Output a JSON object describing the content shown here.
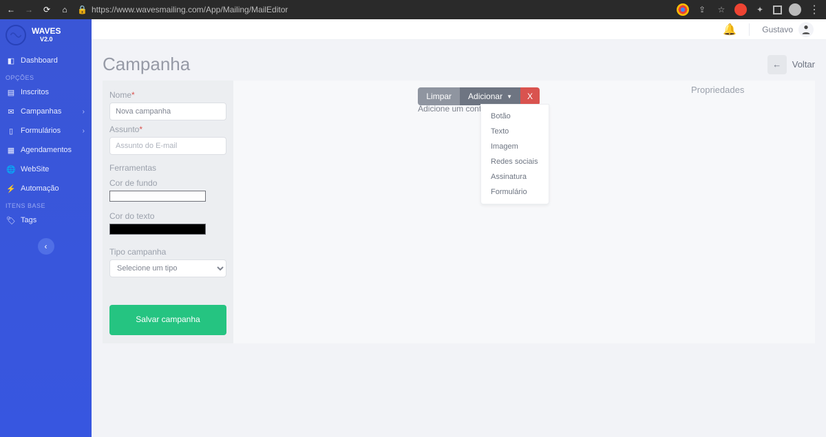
{
  "browser": {
    "url": "https://www.wavesmailing.com/App/Mailing/MailEditor"
  },
  "brand": {
    "name": "WAVES",
    "version": "V2.0"
  },
  "sidebar": {
    "items": [
      {
        "label": "Dashboard",
        "icon": "dashboard",
        "expandable": false
      },
      {
        "section": "OPÇÕES"
      },
      {
        "label": "Inscritos",
        "icon": "users",
        "expandable": false
      },
      {
        "label": "Campanhas",
        "icon": "envelope",
        "expandable": true
      },
      {
        "label": "Formulários",
        "icon": "file",
        "expandable": true
      },
      {
        "label": "Agendamentos",
        "icon": "calendar",
        "expandable": false
      },
      {
        "label": "WebSite",
        "icon": "globe",
        "expandable": false
      },
      {
        "label": "Automação",
        "icon": "bolt",
        "expandable": false
      },
      {
        "section": "ITENS BASE"
      },
      {
        "label": "Tags",
        "icon": "tag",
        "expandable": false
      }
    ]
  },
  "topbar": {
    "username": "Gustavo"
  },
  "page": {
    "title": "Campanha",
    "back_label": "Voltar"
  },
  "form": {
    "name_label": "Nome",
    "name_value": "Nova campanha",
    "subject_label": "Assunto",
    "subject_placeholder": "Assunto do E-mail",
    "tools_label": "Ferramentas",
    "bg_label": "Cor de fundo",
    "bg_value": "#fdfdfd",
    "fg_label": "Cor do texto",
    "fg_value": "#000000",
    "type_label": "Tipo campanha",
    "type_placeholder": "Selecione um tipo",
    "save_label": "Salvar campanha"
  },
  "canvas": {
    "empty_text": "Adicione um conteúdo",
    "toolbar": {
      "clear": "Limpar",
      "add": "Adicionar",
      "delete": "X"
    },
    "add_menu": [
      "Botão",
      "Texto",
      "Imagem",
      "Redes sociais",
      "Assinatura",
      "Formulário"
    ]
  },
  "props": {
    "title": "Propriedades"
  }
}
